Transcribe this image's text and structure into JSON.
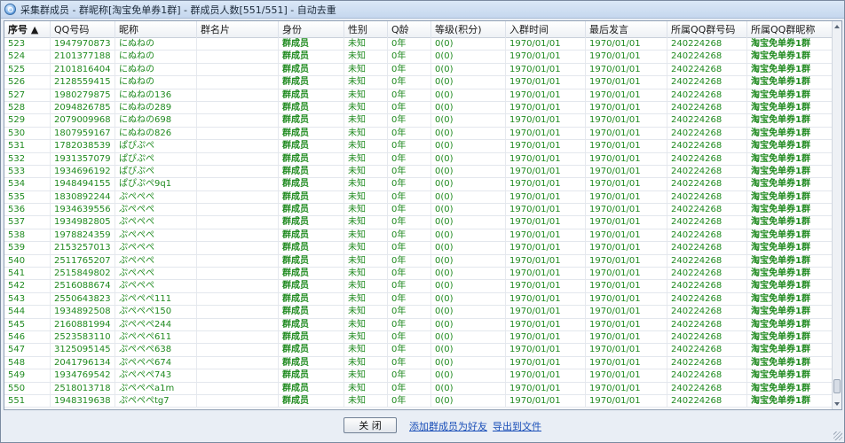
{
  "window": {
    "title": "采集群成员 - 群昵称[淘宝免单券1群] - 群成员人数[551/551] - 自动去重"
  },
  "table": {
    "columns": [
      "序号 ▲",
      "QQ号码",
      "昵称",
      "群名片",
      "身份",
      "性别",
      "Q龄",
      "等级(积分)",
      "入群时间",
      "最后发言",
      "所属QQ群号码",
      "所属QQ群昵称"
    ],
    "rows": [
      [
        "523",
        "1947970873",
        "にぬねの",
        "",
        "群成员",
        "未知",
        "0年",
        "0(0)",
        "1970/01/01",
        "1970/01/01",
        "240224268",
        "淘宝免单券1群"
      ],
      [
        "524",
        "2101377188",
        "にぬねの",
        "",
        "群成员",
        "未知",
        "0年",
        "0(0)",
        "1970/01/01",
        "1970/01/01",
        "240224268",
        "淘宝免单券1群"
      ],
      [
        "525",
        "2101816404",
        "にぬねの",
        "",
        "群成员",
        "未知",
        "0年",
        "0(0)",
        "1970/01/01",
        "1970/01/01",
        "240224268",
        "淘宝免单券1群"
      ],
      [
        "526",
        "2128559415",
        "にぬねの",
        "",
        "群成员",
        "未知",
        "0年",
        "0(0)",
        "1970/01/01",
        "1970/01/01",
        "240224268",
        "淘宝免单券1群"
      ],
      [
        "527",
        "1980279875",
        "にぬねの136",
        "",
        "群成员",
        "未知",
        "0年",
        "0(0)",
        "1970/01/01",
        "1970/01/01",
        "240224268",
        "淘宝免单券1群"
      ],
      [
        "528",
        "2094826785",
        "にぬねの289",
        "",
        "群成员",
        "未知",
        "0年",
        "0(0)",
        "1970/01/01",
        "1970/01/01",
        "240224268",
        "淘宝免单券1群"
      ],
      [
        "529",
        "2079009968",
        "にぬねの698",
        "",
        "群成员",
        "未知",
        "0年",
        "0(0)",
        "1970/01/01",
        "1970/01/01",
        "240224268",
        "淘宝免单券1群"
      ],
      [
        "530",
        "1807959167",
        "にぬねの826",
        "",
        "群成员",
        "未知",
        "0年",
        "0(0)",
        "1970/01/01",
        "1970/01/01",
        "240224268",
        "淘宝免单券1群"
      ],
      [
        "531",
        "1782038539",
        "ぱぴぷぺ",
        "",
        "群成员",
        "未知",
        "0年",
        "0(0)",
        "1970/01/01",
        "1970/01/01",
        "240224268",
        "淘宝免单券1群"
      ],
      [
        "532",
        "1931357079",
        "ぱぴぷぺ",
        "",
        "群成员",
        "未知",
        "0年",
        "0(0)",
        "1970/01/01",
        "1970/01/01",
        "240224268",
        "淘宝免单券1群"
      ],
      [
        "533",
        "1934696192",
        "ぱぴぷぺ",
        "",
        "群成员",
        "未知",
        "0年",
        "0(0)",
        "1970/01/01",
        "1970/01/01",
        "240224268",
        "淘宝免单券1群"
      ],
      [
        "534",
        "1948494155",
        "ぱぴぷぺ9q1",
        "",
        "群成员",
        "未知",
        "0年",
        "0(0)",
        "1970/01/01",
        "1970/01/01",
        "240224268",
        "淘宝免单券1群"
      ],
      [
        "535",
        "1830892244",
        "ぷぺぺぺ",
        "",
        "群成员",
        "未知",
        "0年",
        "0(0)",
        "1970/01/01",
        "1970/01/01",
        "240224268",
        "淘宝免单券1群"
      ],
      [
        "536",
        "1934639556",
        "ぷぺぺぺ",
        "",
        "群成员",
        "未知",
        "0年",
        "0(0)",
        "1970/01/01",
        "1970/01/01",
        "240224268",
        "淘宝免单券1群"
      ],
      [
        "537",
        "1934982805",
        "ぷぺぺぺ",
        "",
        "群成员",
        "未知",
        "0年",
        "0(0)",
        "1970/01/01",
        "1970/01/01",
        "240224268",
        "淘宝免单券1群"
      ],
      [
        "538",
        "1978824359",
        "ぷぺぺぺ",
        "",
        "群成员",
        "未知",
        "0年",
        "0(0)",
        "1970/01/01",
        "1970/01/01",
        "240224268",
        "淘宝免单券1群"
      ],
      [
        "539",
        "2153257013",
        "ぷぺぺぺ",
        "",
        "群成员",
        "未知",
        "0年",
        "0(0)",
        "1970/01/01",
        "1970/01/01",
        "240224268",
        "淘宝免单券1群"
      ],
      [
        "540",
        "2511765207",
        "ぷぺぺぺ",
        "",
        "群成员",
        "未知",
        "0年",
        "0(0)",
        "1970/01/01",
        "1970/01/01",
        "240224268",
        "淘宝免单券1群"
      ],
      [
        "541",
        "2515849802",
        "ぷぺぺぺ",
        "",
        "群成员",
        "未知",
        "0年",
        "0(0)",
        "1970/01/01",
        "1970/01/01",
        "240224268",
        "淘宝免单券1群"
      ],
      [
        "542",
        "2516088674",
        "ぷぺぺぺ",
        "",
        "群成员",
        "未知",
        "0年",
        "0(0)",
        "1970/01/01",
        "1970/01/01",
        "240224268",
        "淘宝免单券1群"
      ],
      [
        "543",
        "2550643823",
        "ぷぺぺぺ111",
        "",
        "群成员",
        "未知",
        "0年",
        "0(0)",
        "1970/01/01",
        "1970/01/01",
        "240224268",
        "淘宝免单券1群"
      ],
      [
        "544",
        "1934892508",
        "ぷぺぺぺ150",
        "",
        "群成员",
        "未知",
        "0年",
        "0(0)",
        "1970/01/01",
        "1970/01/01",
        "240224268",
        "淘宝免单券1群"
      ],
      [
        "545",
        "2160881994",
        "ぷぺぺぺ244",
        "",
        "群成员",
        "未知",
        "0年",
        "0(0)",
        "1970/01/01",
        "1970/01/01",
        "240224268",
        "淘宝免单券1群"
      ],
      [
        "546",
        "2523583110",
        "ぷぺぺぺ611",
        "",
        "群成员",
        "未知",
        "0年",
        "0(0)",
        "1970/01/01",
        "1970/01/01",
        "240224268",
        "淘宝免单券1群"
      ],
      [
        "547",
        "3125095145",
        "ぷぺぺぺ638",
        "",
        "群成员",
        "未知",
        "0年",
        "0(0)",
        "1970/01/01",
        "1970/01/01",
        "240224268",
        "淘宝免单券1群"
      ],
      [
        "548",
        "2041796134",
        "ぷぺぺぺ674",
        "",
        "群成员",
        "未知",
        "0年",
        "0(0)",
        "1970/01/01",
        "1970/01/01",
        "240224268",
        "淘宝免单券1群"
      ],
      [
        "549",
        "1934769542",
        "ぷぺぺぺ743",
        "",
        "群成员",
        "未知",
        "0年",
        "0(0)",
        "1970/01/01",
        "1970/01/01",
        "240224268",
        "淘宝免单券1群"
      ],
      [
        "550",
        "2518013718",
        "ぷぺぺぺa1m",
        "",
        "群成员",
        "未知",
        "0年",
        "0(0)",
        "1970/01/01",
        "1970/01/01",
        "240224268",
        "淘宝免单券1群"
      ],
      [
        "551",
        "1948319638",
        "ぷぺぺぺtg7",
        "",
        "群成员",
        "未知",
        "0年",
        "0(0)",
        "1970/01/01",
        "1970/01/01",
        "240224268",
        "淘宝免单券1群"
      ]
    ]
  },
  "footer": {
    "close_label": "关 闭",
    "add_friends_label": "添加群成员为好友",
    "export_label": "导出到文件"
  },
  "colors": {
    "row_text": "#1f8a1f",
    "link": "#1a4fb8"
  }
}
